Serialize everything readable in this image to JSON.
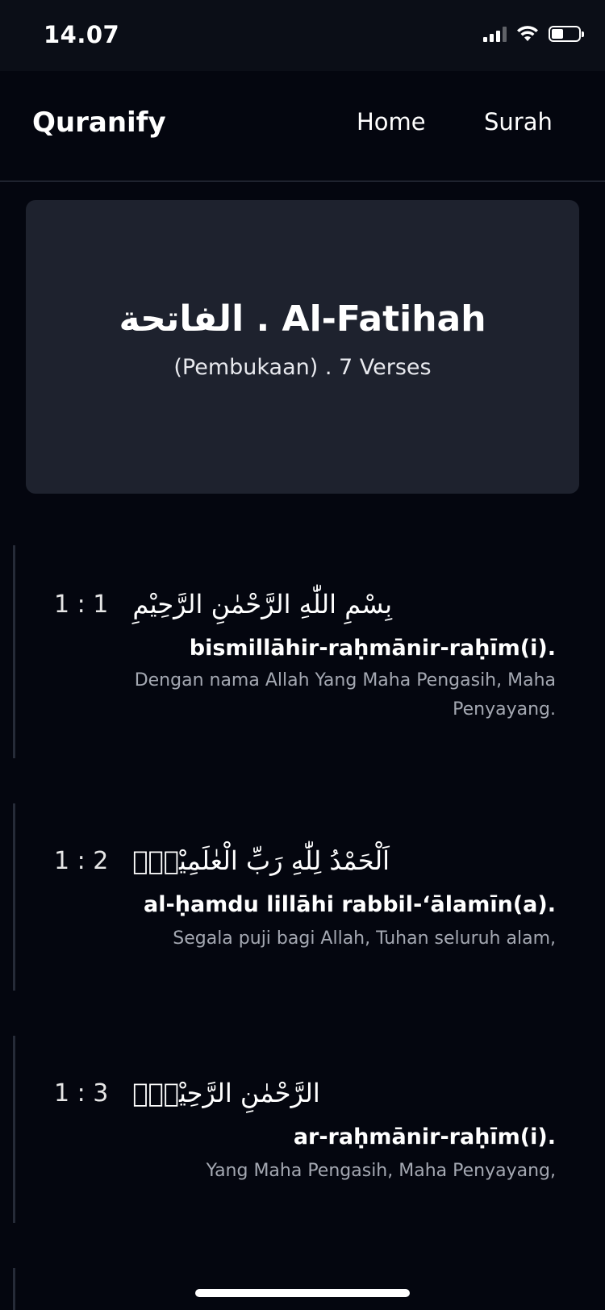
{
  "status_bar": {
    "time": "14.07",
    "icons": [
      "cellular-signal-icon",
      "wifi-icon",
      "battery-icon"
    ]
  },
  "navbar": {
    "brand": "Quranify",
    "links": [
      "Home",
      "Surah"
    ]
  },
  "surah": {
    "title": "الفاتحة . Al-Fatihah",
    "subtitle": "(Pembukaan) . 7 Verses"
  },
  "verses": [
    {
      "number": "1 : 1",
      "arabic": "بِسْمِ اللّٰهِ الرَّحْمٰنِ الرَّحِيْمِ",
      "latin": "bismillāhir-raḥmānir-raḥīm(i).",
      "translation": "Dengan nama Allah Yang Maha Pengasih, Maha Penyayang."
    },
    {
      "number": "1 : 2",
      "arabic": "اَلْحَمْدُ لِلّٰهِ رَبِّ الْعٰلَمِيْنَۙ",
      "latin": "al-ḥamdu lillāhi rabbil-‘ālamīn(a).",
      "translation": "Segala puji bagi Allah, Tuhan seluruh alam,"
    },
    {
      "number": "1 : 3",
      "arabic": "الرَّحْمٰنِ الرَّحِيْمِۙ",
      "latin": "ar-raḥmānir-raḥīm(i).",
      "translation": "Yang Maha Pengasih, Maha Penyayang,"
    }
  ],
  "colors": {
    "background": "#04060f",
    "card": "#1e222e",
    "translation_text": "#a4a8b2"
  }
}
